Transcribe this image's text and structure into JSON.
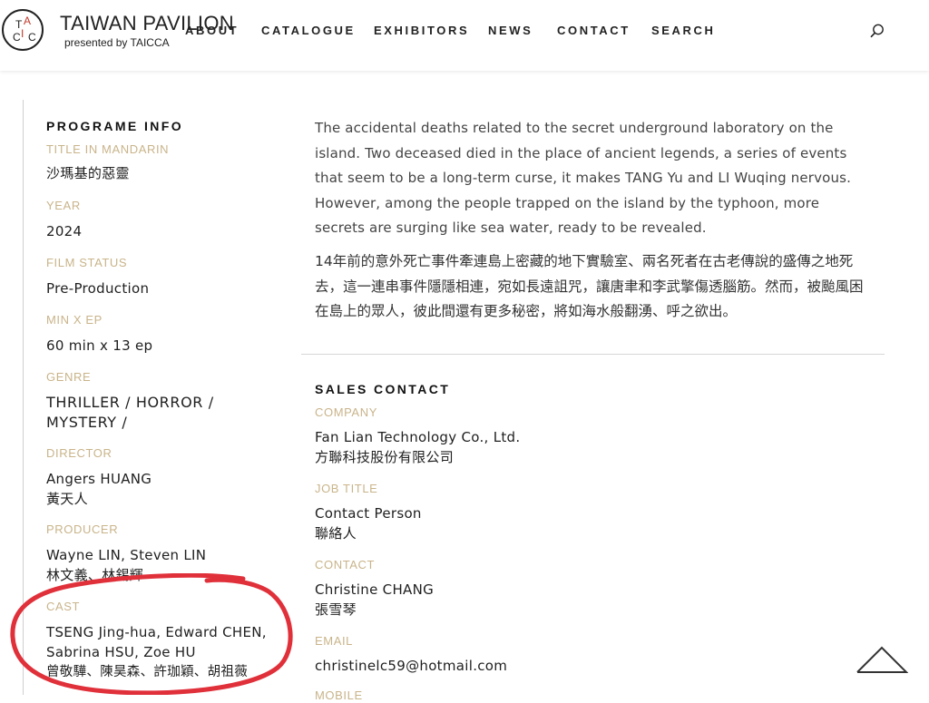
{
  "header": {
    "brand_title": "TAIWAN PAVILION",
    "brand_sub": "presented by TAICCA",
    "logo_letters": [
      "T",
      "A",
      "I",
      "C",
      "C",
      "A"
    ],
    "nav": [
      "ABOUT",
      "CATALOGUE",
      "EXHIBITORS",
      "NEWS",
      "CONTACT",
      "SEARCH"
    ],
    "search_icon": "magnifier-icon"
  },
  "sidebar": {
    "title": "PROGRAME INFO",
    "fields": [
      {
        "label": "TITLE IN MANDARIN",
        "value": [
          "沙瑪基的惡靈"
        ]
      },
      {
        "label": "YEAR",
        "value": [
          "2024"
        ]
      },
      {
        "label": "FILM STATUS",
        "value": [
          "Pre-Production"
        ]
      },
      {
        "label": "MIN X EP",
        "value": [
          "60 min x 13 ep"
        ]
      },
      {
        "label": "GENRE",
        "value": [
          "THRILLER / HORROR /",
          "MYSTERY /"
        ]
      },
      {
        "label": "DIRECTOR",
        "value": [
          "Angers HUANG",
          "黃天人"
        ]
      },
      {
        "label": "PRODUCER",
        "value": [
          "Wayne LIN, Steven LIN",
          "林文義、林錫輝"
        ]
      },
      {
        "label": "CAST",
        "value": [
          "TSENG Jing-hua, Edward CHEN,",
          "Sabrina HSU, Zoe HU",
          "曾敬驊、陳昊森、許珈穎、胡祖薇"
        ]
      }
    ]
  },
  "main": {
    "description_en": "The accidental deaths related to the secret underground laboratory on the island. Two deceased died in the place of ancient legends, a series of events that seem to be a long-term curse, it makes TANG Yu and LI Wuqing nervous. However, among the people trapped on the island by the typhoon, more secrets are surging like sea water, ready to be revealed.",
    "description_zh": "14年前的意外死亡事件牽連島上密藏的地下實驗室、兩名死者在古老傳說的盛傳之地死去，這一連串事件隱隱相連，宛如長遠詛咒，讓唐聿和李武擎傷透腦筋。然而，被颱風困在島上的眾人，彼此間還有更多秘密，將如海水般翻湧、呼之欲出。",
    "sales": {
      "title": "SALES CONTACT",
      "fields": [
        {
          "label": "COMPANY",
          "value": [
            "Fan Lian Technology Co., Ltd.",
            "方聯科技股份有限公司"
          ]
        },
        {
          "label": "JOB TITLE",
          "value": [
            "Contact Person",
            "聯絡人"
          ]
        },
        {
          "label": "CONTACT",
          "value": [
            "Christine CHANG",
            "張雪琴"
          ]
        },
        {
          "label": "EMAIL",
          "value": [
            "christinelc59@hotmail.com"
          ]
        },
        {
          "label": "MOBILE",
          "value": []
        }
      ]
    }
  },
  "colors": {
    "label_gold": "#c9b48a",
    "annotation_red": "#e0303a",
    "text_dark": "#1f1f1f"
  },
  "scroll_top_icon": "chevron-up-icon"
}
